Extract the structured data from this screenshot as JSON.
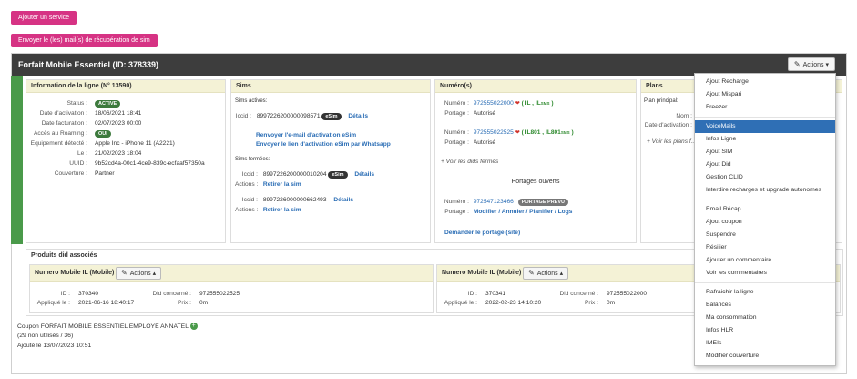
{
  "top_buttons": {
    "add_service": "Ajouter un service",
    "send_mail": "Envoyer le (les) mail(s) de récupération de sim"
  },
  "panel": {
    "title": "Forfait Mobile Essentiel (ID: 378339)",
    "actions_label": "Actions"
  },
  "info": {
    "title": "Information de la ligne (N° 13590)",
    "rows": [
      {
        "label": "Status :",
        "value": "ACTIVE"
      },
      {
        "label": "Date d'activation :",
        "value": "18/06/2021 18:41"
      },
      {
        "label": "Date facturation :",
        "value": "02/07/2023 00:00"
      },
      {
        "label": "Accès au Roaming :",
        "value": "OUI"
      },
      {
        "label": "Equipement détecté :",
        "value": "Apple Inc - iPhone 11 (A2221)"
      },
      {
        "label": "Le :",
        "value": "21/02/2023 18:04"
      },
      {
        "label": "UUID :",
        "value": "9b52cd4a-00c1-4ce9-839c-ecfaaf57350a"
      },
      {
        "label": "Couverture :",
        "value": "Partner"
      }
    ]
  },
  "sims": {
    "title": "Sims",
    "active_title": "Sims actives:",
    "active": {
      "label": "Iccid :",
      "iccid": "8997226200000098571",
      "badge": "eSim",
      "details": "Détails"
    },
    "resend_esim": "Renvoyer l'e-mail d'activation eSim",
    "send_whatsapp": "Envoyer le lien d'activation eSim par Whatsapp",
    "closed_title": "Sims fermées:",
    "closed": [
      {
        "iccid_label": "Iccid :",
        "iccid": "8997226200000010204",
        "badge": "eSim",
        "details": "Détails",
        "actions_label": "Actions :",
        "action": "Retirer la sim"
      },
      {
        "iccid_label": "Iccid :",
        "iccid": "8997226000000662493",
        "badge": "",
        "details": "Détails",
        "actions_label": "Actions :",
        "action": "Retirer la sim"
      }
    ]
  },
  "numeros": {
    "title": "Numéro(s)",
    "items": [
      {
        "num_label": "Numéro :",
        "number": "972555022000",
        "tags_pre": "( IL ,",
        "tags_post": "IL",
        "sub": "SMS",
        "close": ")",
        "portage_label": "Portage :",
        "portage": "Autorisé"
      },
      {
        "num_label": "Numéro :",
        "number": "972555022525",
        "tags_pre": "( IL801 ,",
        "tags_post": "IL801",
        "sub": "SMS",
        "close": ")",
        "portage_label": "Portage :",
        "portage": "Autorisé"
      }
    ],
    "see_did": "+ Voir les dids fermés",
    "ports_title": "Portages ouverts",
    "port": {
      "num_label": "Numéro :",
      "number": "972547123466",
      "badge": "PORTAGE PREVU",
      "portage_label": "Portage :",
      "actions": "Modifier / Annuler / Planifier / Logs"
    },
    "request_port": "Demander le portage (site)"
  },
  "plans": {
    "title": "Plans",
    "principal": "Plan principal:",
    "nom_label": "Nom :",
    "date_label": "Date d'activation :",
    "see_closed": "+ Voir les plans f..."
  },
  "produits": {
    "title": "Produits did associés",
    "cards": [
      {
        "title": "Numero Mobile IL (Mobile)",
        "actions": "Actions",
        "id_label": "ID :",
        "id": "370340",
        "applied_label": "Appliqué le :",
        "applied": "2021-06-16 18:40:17",
        "did_label": "Did concerné :",
        "did": "972555022525",
        "prix_label": "Prix :",
        "prix": "0m"
      },
      {
        "title": "Numero Mobile IL (Mobile)",
        "actions": "Actions",
        "id_label": "ID :",
        "id": "370341",
        "applied_label": "Appliqué le :",
        "applied": "2022-02-23 14:10:20",
        "did_label": "Did concerné :",
        "did": "972555022000",
        "prix_label": "Prix :",
        "prix": "0m"
      }
    ]
  },
  "coupon": {
    "line1": "Coupon FORFAIT MOBILE ESSENTIEL EMPLOYE ANNATEL",
    "line2": "(29 non utilisés / 36)",
    "line3": "Ajouté le 13/07/2023 10:51"
  },
  "dropdown": {
    "groups": [
      [
        "Ajout Recharge",
        "Ajout Mispari",
        "Freezer"
      ],
      [
        "VoiceMails",
        "Infos Ligne",
        "Ajout SIM",
        "Ajout Did",
        "Gestion CLID",
        "Interdire recharges et upgrade autonomes"
      ],
      [
        "Email Récap",
        "Ajout coupon",
        "Suspendre",
        "Résilier",
        "Ajouter un commentaire",
        "Voir les commentaires"
      ],
      [
        "Rafraichir la ligne",
        "Balances",
        "Ma consommation",
        "Infos HLR",
        "IMEIs",
        "Modifier couverture"
      ]
    ],
    "active_item": "VoiceMails"
  },
  "colors": {
    "pink": "#d63384",
    "header_dark": "#3d3d3d",
    "box_head": "#f4f2d6",
    "accent_blue": "#2f6fb5",
    "status_green": "#3d7a3d"
  }
}
